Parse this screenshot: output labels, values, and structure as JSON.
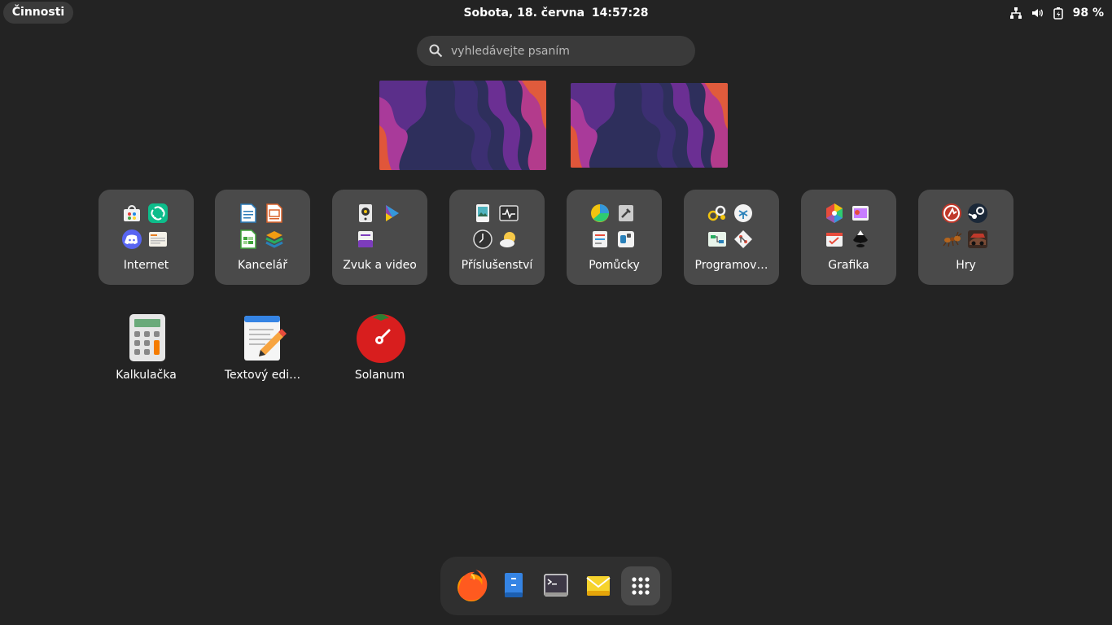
{
  "topbar": {
    "activities_label": "Činnosti",
    "date": "Sobota, 18. června",
    "time": "14:57:28",
    "battery_percent": "98 %",
    "tray_icons": [
      "network-icon",
      "volume-icon",
      "battery-icon"
    ]
  },
  "search": {
    "placeholder": "vyhledávejte psaním"
  },
  "folders": [
    {
      "label": "Internet",
      "icons": [
        "store-icon",
        "element-icon",
        "discord-icon",
        "feed-reader-icon"
      ]
    },
    {
      "label": "Kancelář",
      "icons": [
        "writer-icon",
        "impress-icon",
        "calc-sheet-icon",
        "layers-icon"
      ]
    },
    {
      "label": "Zvuk a video",
      "icons": [
        "speaker-icon",
        "video-player-icon",
        "media-icon",
        ""
      ]
    },
    {
      "label": "Příslušenství",
      "icons": [
        "image-viewer-icon",
        "system-monitor-icon",
        "clock-icon",
        "weather-icon"
      ]
    },
    {
      "label": "Pomůcky",
      "icons": [
        "disk-usage-icon",
        "settings-tools-icon",
        "documents-icon",
        "tweaks-icon"
      ]
    },
    {
      "label": "Programov…",
      "icons": [
        "builder-icon",
        "debugger-icon",
        "diagram-icon",
        "git-icon"
      ]
    },
    {
      "label": "Grafika",
      "icons": [
        "color-picker-icon",
        "image-editor-icon",
        "tasks-icon",
        "inkscape-icon"
      ]
    },
    {
      "label": "Hry",
      "icons": [
        "game-icon",
        "steam-icon",
        "ant-game-icon",
        "racing-game-icon"
      ]
    }
  ],
  "apps": [
    {
      "label": "Kalkulačka",
      "icon": "calculator-icon"
    },
    {
      "label": "Textový edi…",
      "icon": "text-editor-icon"
    },
    {
      "label": "Solanum",
      "icon": "tomato-timer-icon"
    }
  ],
  "dash": {
    "items": [
      "firefox-icon",
      "files-icon",
      "terminal-icon",
      "mail-icon",
      "app-grid-icon"
    ]
  },
  "colors": {
    "background": "#232323",
    "folder_bg": "#4a4a4a",
    "search_bg": "#3a3a3a",
    "dash_bg": "#2f2f2f"
  }
}
